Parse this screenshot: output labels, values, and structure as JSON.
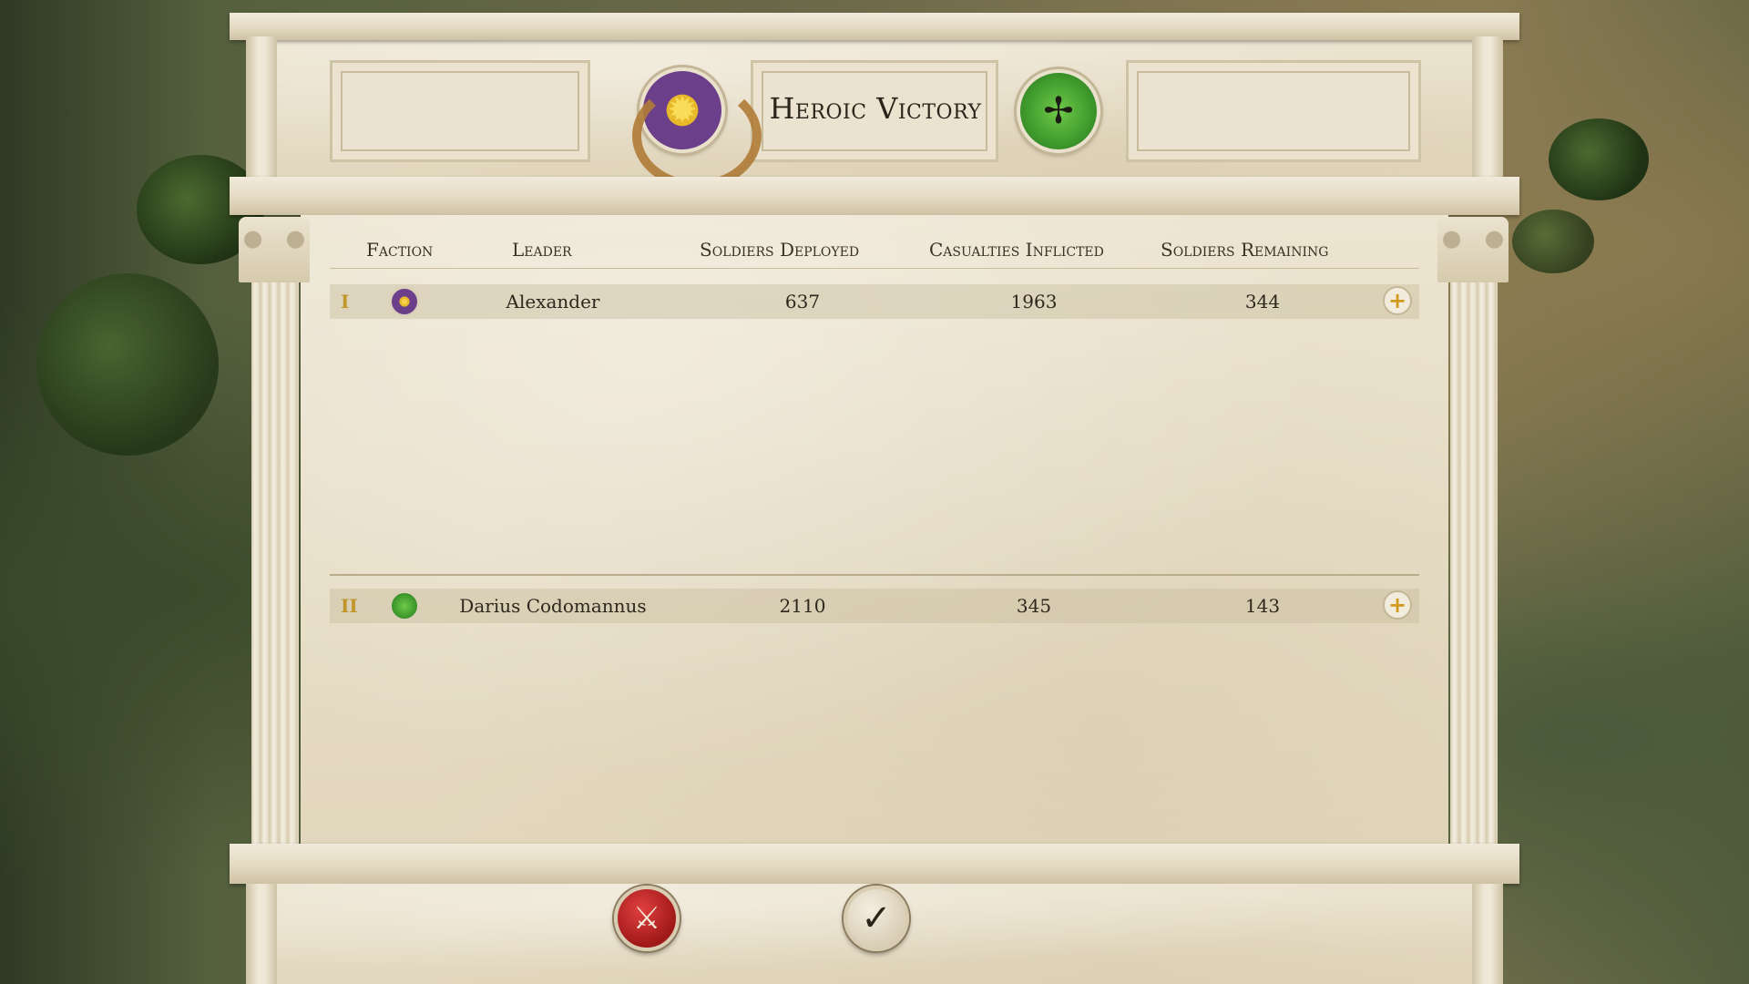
{
  "header": {
    "title": "Heroic Victory",
    "left_emblem_icon": "sun-star-icon",
    "right_emblem_icon": "eagle-icon"
  },
  "table": {
    "columns": {
      "faction": "Faction",
      "leader": "Leader",
      "deployed": "Soldiers Deployed",
      "inflicted": "Casualties Inflicted",
      "remaining": "Soldiers Remaining"
    },
    "rows": [
      {
        "rank": "I",
        "faction_icon": "sun-star-icon",
        "leader": "Alexander",
        "deployed": "637",
        "inflicted": "1963",
        "remaining": "344",
        "expand_label": "+"
      },
      {
        "rank": "II",
        "faction_icon": "eagle-icon",
        "leader": "Darius Codomannus",
        "deployed": "2110",
        "inflicted": "345",
        "remaining": "143",
        "expand_label": "+"
      }
    ]
  },
  "footer": {
    "retreat_icon": "crossed-swords-icon",
    "confirm_icon": "checkmark-icon"
  },
  "colors": {
    "rank_gold": "#c0962a",
    "faction_purple": "#6b3f8a",
    "faction_green": "#3f9a2c",
    "retreat_red": "#a01818"
  }
}
